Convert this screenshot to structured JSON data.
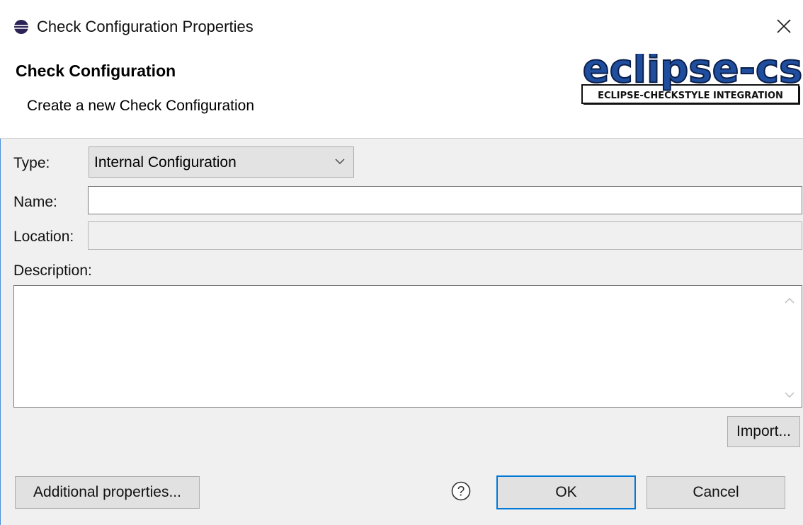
{
  "window": {
    "title": "Check Configuration Properties",
    "close_glyph": "✕",
    "app_icon": "eclipse-icon"
  },
  "banner": {
    "title": "Check Configuration",
    "description": "Create a new Check Configuration",
    "logo_text": "eclipse-cs",
    "logo_subtext": "ECLIPSE-CHECKSTYLE INTEGRATION"
  },
  "form": {
    "type_label": "Type:",
    "type_value": "Internal Configuration",
    "name_label": "Name:",
    "name_value": "",
    "location_label": "Location:",
    "location_value": "",
    "description_label": "Description:",
    "description_value": ""
  },
  "buttons": {
    "import": "Import...",
    "additional_properties": "Additional properties...",
    "ok": "OK",
    "cancel": "Cancel"
  },
  "colors": {
    "accent": "#0078d7",
    "logo_blue": "#1f4e9e"
  }
}
